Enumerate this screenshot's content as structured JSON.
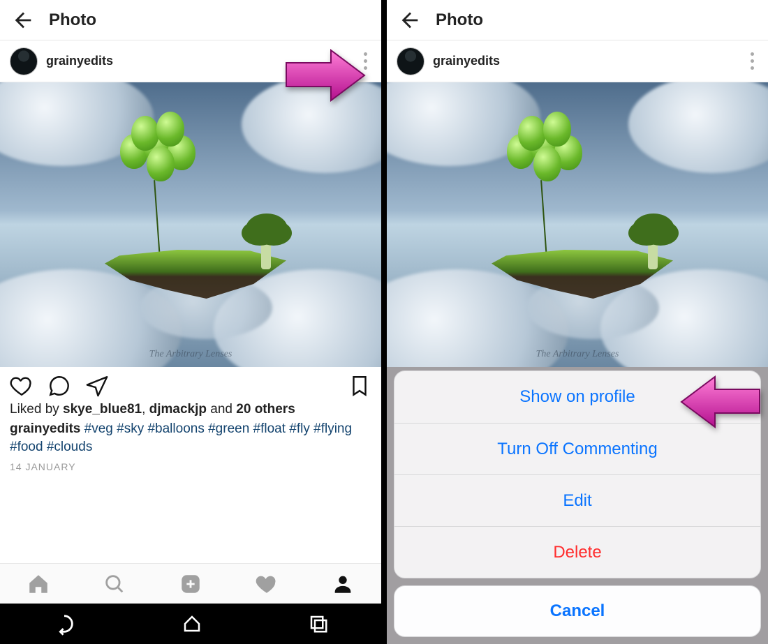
{
  "header": {
    "title": "Photo"
  },
  "post": {
    "username": "grainyedits",
    "watermark": "The Arbitrary Lenses",
    "liked_by_prefix": "Liked by ",
    "liker1": "skye_blue81",
    "sep1": ", ",
    "liker2": "djmackjp",
    "sep2": " and ",
    "others": "20 others",
    "hashtags": "#veg #sky #balloons #green #float #fly #flying #food #clouds",
    "date": "14 JANUARY"
  },
  "sheet": {
    "show": "Show on profile",
    "turn": "Turn Off Commenting",
    "edit": "Edit",
    "delete": "Delete",
    "cancel": "Cancel"
  }
}
